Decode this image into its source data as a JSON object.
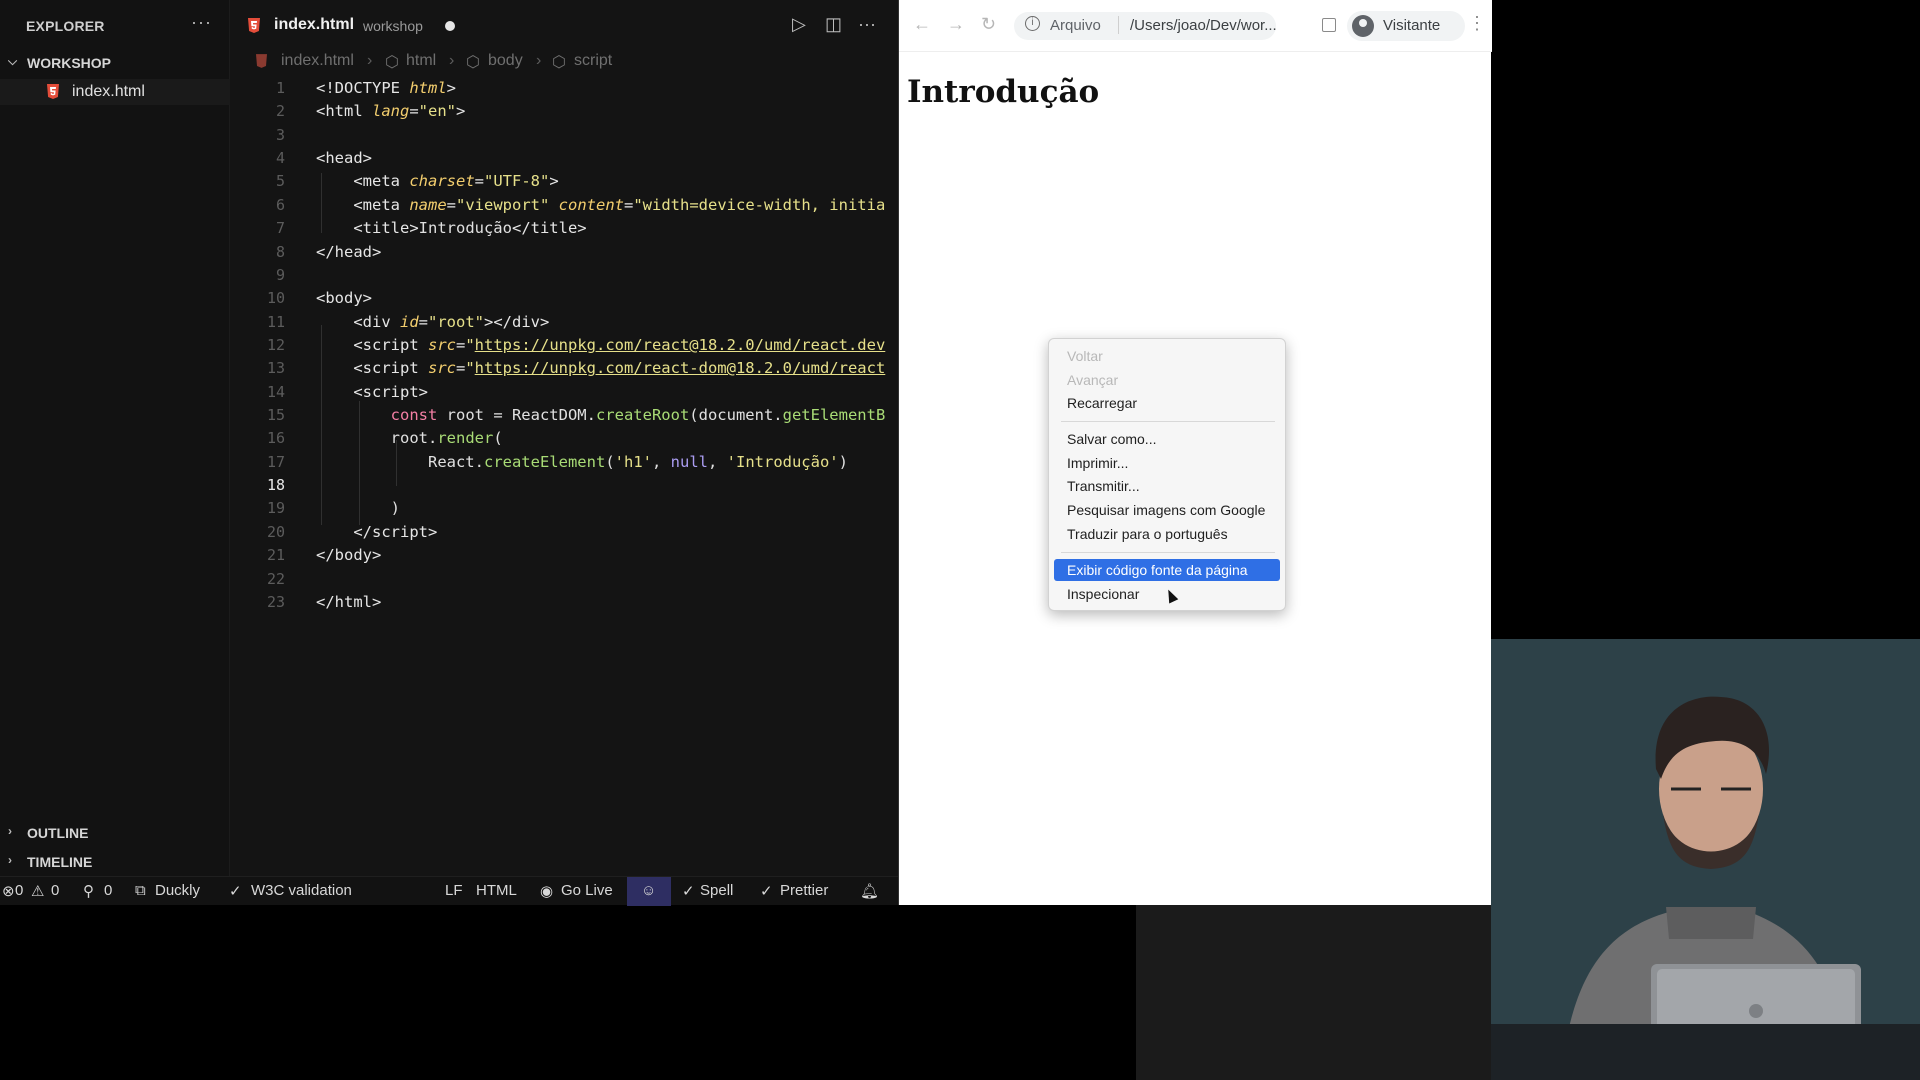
{
  "explorer": {
    "title": "EXPLORER",
    "workspace": "WORKSHOP",
    "file": "index.html",
    "outline": "OUTLINE",
    "timeline": "TIMELINE"
  },
  "tab": {
    "name": "index.html",
    "folder": "workshop"
  },
  "breadcrumb": [
    "index.html",
    "html",
    "body",
    "script"
  ],
  "editor": {
    "current_line": 18
  },
  "statusbar": {
    "errors": "0",
    "warnings": "0",
    "ports": "0",
    "duckly": "Duckly",
    "w3c": "W3C validation",
    "eol": "LF",
    "language": "HTML",
    "golive": "Go Live",
    "spell": "Spell",
    "prettier": "Prettier"
  },
  "browser": {
    "scheme": "Arquivo",
    "path": "/Users/joao/Dev/wor...",
    "profile": "Visitante",
    "page_heading": "Introdução"
  },
  "context_menu": {
    "items": [
      {
        "label": "Voltar",
        "state": "disabled"
      },
      {
        "label": "Avançar",
        "state": "disabled"
      },
      {
        "label": "Recarregar",
        "state": "enabled"
      },
      {
        "label": "Salvar como...",
        "state": "enabled"
      },
      {
        "label": "Imprimir...",
        "state": "enabled"
      },
      {
        "label": "Transmitir...",
        "state": "enabled"
      },
      {
        "label": "Pesquisar imagens com Google",
        "state": "enabled"
      },
      {
        "label": "Traduzir para o português",
        "state": "enabled"
      },
      {
        "label": "Exibir código fonte da página",
        "state": "selected"
      },
      {
        "label": "Inspecionar",
        "state": "enabled"
      }
    ]
  },
  "colors": {
    "selection": "#2f6fe5",
    "file_icon": "#e44d3a",
    "editor_bg": "#141414"
  }
}
